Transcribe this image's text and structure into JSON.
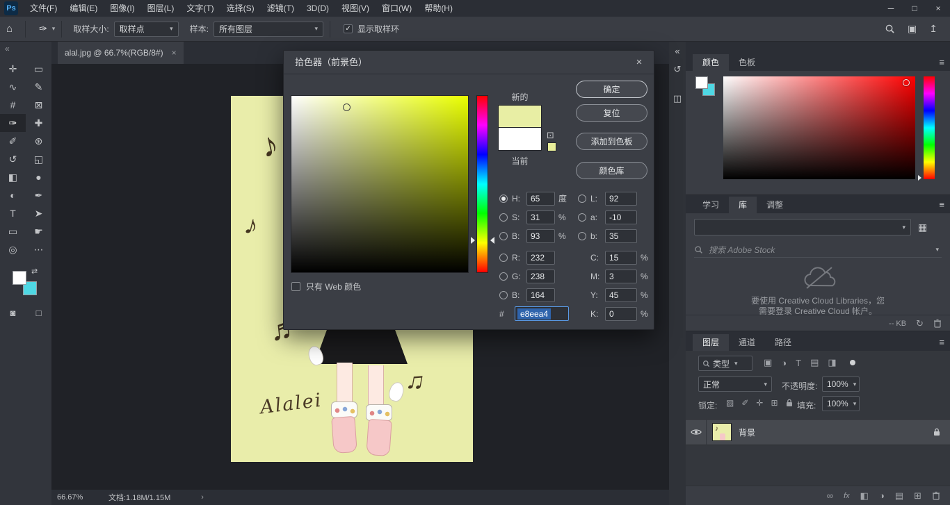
{
  "colors": {
    "foreground": "#ffffff",
    "background": "#4fd8e4",
    "picker_new": "#e8eea4",
    "picker_current": "#ffffff",
    "canvas_background": "#e9edaa",
    "selection_blue": "#2f64ac"
  },
  "icons": {
    "ps_logo": "Ps",
    "minimize": "─",
    "maximize": "□",
    "close": "×",
    "home": "⌂",
    "eyedropper": "✑",
    "caret_down": "▾",
    "chevron_right": "›",
    "check": "✓",
    "hamburger": "≡",
    "collapse_left": "«",
    "swap": "⇄",
    "history": "↺",
    "properties": "◫",
    "workspace": "▣",
    "share": "↥",
    "grid": "▦",
    "sync": "↻",
    "link": "∞",
    "fx": "fx",
    "mask": "◧",
    "adjustment": "◑",
    "folder": "▤",
    "new_layer": "⊞",
    "filter_image": "▣",
    "filter_type": "T",
    "filter_smart": "◨",
    "lock_transparency": "▨",
    "lock_paint": "✐",
    "lock_position": "✛",
    "lock_artboard": "⊞",
    "quick_mask": "◙",
    "screen_mode": "□",
    "gamut_cube": "⊡"
  },
  "menu_bar": {
    "items": [
      "文件(F)",
      "编辑(E)",
      "图像(I)",
      "图层(L)",
      "文字(T)",
      "选择(S)",
      "滤镜(T)",
      "3D(D)",
      "视图(V)",
      "窗口(W)",
      "帮助(H)"
    ]
  },
  "options_bar": {
    "sample_size_label": "取样大小:",
    "sample_size_value": "取样点",
    "sample_label": "样本:",
    "sample_value": "所有图层",
    "show_ring_label": "显示取样环"
  },
  "tools": [
    {
      "name": "move-tool",
      "glyph": "✛"
    },
    {
      "name": "marquee-tool",
      "glyph": "▭"
    },
    {
      "name": "lasso-tool",
      "glyph": "∿"
    },
    {
      "name": "quick-selection-tool",
      "glyph": "✎"
    },
    {
      "name": "crop-tool",
      "glyph": "#"
    },
    {
      "name": "frame-tool",
      "glyph": "⊠"
    },
    {
      "name": "eyedropper-tool",
      "glyph": "✑",
      "active": true
    },
    {
      "name": "ruler-tool",
      "glyph": "✚"
    },
    {
      "name": "brush-tool",
      "glyph": "✐"
    },
    {
      "name": "clone-stamp-tool",
      "glyph": "⊛"
    },
    {
      "name": "history-brush-tool",
      "glyph": "↺"
    },
    {
      "name": "eraser-tool",
      "glyph": "◱"
    },
    {
      "name": "gradient-tool",
      "glyph": "◧"
    },
    {
      "name": "blur-tool",
      "glyph": "●"
    },
    {
      "name": "dodge-tool",
      "glyph": "◐"
    },
    {
      "name": "pen-tool",
      "glyph": "✒"
    },
    {
      "name": "type-tool",
      "glyph": "T"
    },
    {
      "name": "path-selection-tool",
      "glyph": "➤"
    },
    {
      "name": "rectangle-tool",
      "glyph": "▭"
    },
    {
      "name": "hand-tool",
      "glyph": "☛"
    },
    {
      "name": "zoom-tool",
      "glyph": "◎"
    },
    {
      "name": "more-tools",
      "glyph": "⋯"
    }
  ],
  "document": {
    "tab_title": "alal.jpg @ 66.7%(RGB/8#)",
    "signature": "Alalei",
    "notes": [
      "♪",
      "♪",
      "♬",
      "♫"
    ]
  },
  "color_picker": {
    "title": "拾色器（前景色）",
    "new_label": "新的",
    "current_label": "当前",
    "ok": "确定",
    "reset": "复位",
    "add_to_swatches": "添加到色板",
    "color_libraries": "颜色库",
    "web_only": "只有 Web 颜色",
    "hex_prefix": "#",
    "hex_value": "e8eea4",
    "hsb": {
      "h": {
        "label": "H:",
        "value": "65",
        "unit": "度"
      },
      "s": {
        "label": "S:",
        "value": "31",
        "unit": "%"
      },
      "b": {
        "label": "B:",
        "value": "93",
        "unit": "%"
      }
    },
    "rgb": {
      "r": {
        "label": "R:",
        "value": "232"
      },
      "g": {
        "label": "G:",
        "value": "238"
      },
      "b": {
        "label": "B:",
        "value": "164"
      }
    },
    "lab": {
      "l": {
        "label": "L:",
        "value": "92"
      },
      "a": {
        "label": "a:",
        "value": "-10"
      },
      "b": {
        "label": "b:",
        "value": "35"
      }
    },
    "cmyk": {
      "c": {
        "label": "C:",
        "value": "15",
        "unit": "%"
      },
      "m": {
        "label": "M:",
        "value": "3",
        "unit": "%"
      },
      "y": {
        "label": "Y:",
        "value": "45",
        "unit": "%"
      },
      "k": {
        "label": "K:",
        "value": "0",
        "unit": "%"
      }
    }
  },
  "panels": {
    "color": {
      "tabs": [
        {
          "label": "颜色",
          "active": true
        },
        {
          "label": "色板",
          "active": false
        }
      ]
    },
    "libraries": {
      "tabs": [
        {
          "label": "学习",
          "active": false
        },
        {
          "label": "库",
          "active": true
        },
        {
          "label": "调整",
          "active": false
        }
      ],
      "search_placeholder": "搜索 Adobe Stock",
      "message_line1": "要使用 Creative Cloud Libraries，您",
      "message_line2": "需要登录 Creative Cloud 帐户。",
      "size_text": "-- KB"
    },
    "layers": {
      "tabs": [
        {
          "label": "图层",
          "active": true
        },
        {
          "label": "通道",
          "active": false
        },
        {
          "label": "路径",
          "active": false
        }
      ],
      "filter_label": "类型",
      "blend_mode": "正常",
      "opacity_label": "不透明度:",
      "opacity_value": "100%",
      "lock_label": "锁定:",
      "fill_label": "填充:",
      "fill_value": "100%",
      "layers": [
        {
          "name": "背景",
          "visible": true,
          "locked": true
        }
      ]
    }
  },
  "status_bar": {
    "zoom": "66.67%",
    "doc_info": "文档:1.18M/1.15M"
  }
}
